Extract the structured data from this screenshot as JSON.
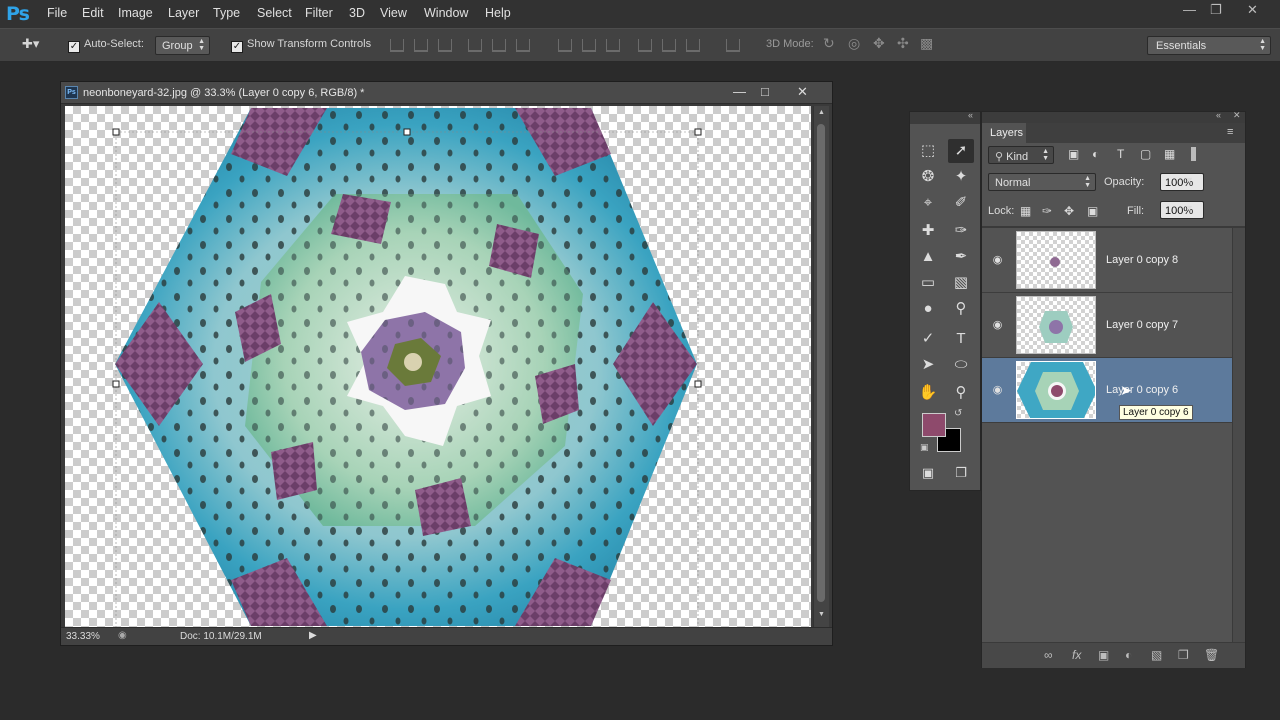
{
  "app": {
    "logo": "Ps"
  },
  "menu": [
    "File",
    "Edit",
    "Image",
    "Layer",
    "Type",
    "Select",
    "Filter",
    "3D",
    "View",
    "Window",
    "Help"
  ],
  "options": {
    "auto_select_label": "Auto-Select:",
    "auto_select_checked": true,
    "group_value": "Group",
    "transform_label": "Show Transform Controls",
    "transform_checked": true,
    "mode3d_label": "3D Mode:",
    "workspace": "Essentials"
  },
  "document": {
    "title": "neonboneyard-32.jpg @ 33.3% (Layer 0 copy 6, RGB/8) *",
    "zoom": "33.33%",
    "doc_size": "Doc: 10.1M/29.1M"
  },
  "layers_panel": {
    "tab": "Layers",
    "kind_filter": "Kind",
    "blend_mode": "Normal",
    "opacity_label": "Opacity:",
    "opacity": "100%",
    "lock_label": "Lock:",
    "fill_label": "Fill:",
    "fill": "100%",
    "layers": [
      {
        "name": "Layer 0 copy 8",
        "visible": true,
        "selected": false
      },
      {
        "name": "Layer 0 copy 7",
        "visible": true,
        "selected": false
      },
      {
        "name": "Layer 0 copy 6",
        "visible": true,
        "selected": true
      }
    ],
    "tooltip": "Layer 0 copy 6"
  },
  "colors": {
    "foreground": "#8e4a6c",
    "background": "#000000",
    "selection": "#5d7a9c"
  }
}
